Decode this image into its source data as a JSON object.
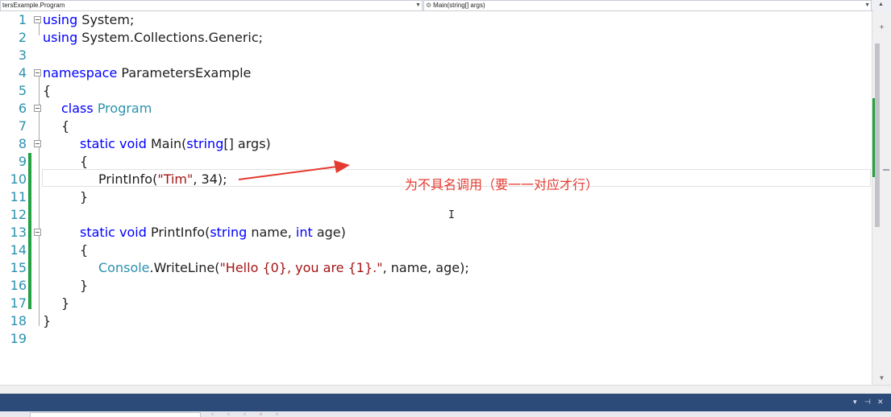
{
  "navbar": {
    "class_dropdown": "tersExample.Program",
    "member_dropdown": "Main(string[] args)"
  },
  "line_numbers": [
    "1",
    "2",
    "3",
    "4",
    "5",
    "6",
    "7",
    "8",
    "9",
    "10",
    "11",
    "12",
    "13",
    "14",
    "15",
    "16",
    "17",
    "18",
    "19"
  ],
  "code": {
    "l1_kw": "using",
    "l1_rest": " System;",
    "l2_kw": "using",
    "l2_rest": " System.Collections.Generic;",
    "l4_kw": "namespace",
    "l4_rest": " ParametersExample",
    "brace_open": "{",
    "brace_close": "}",
    "l6_kw": "class",
    "l6_ty": "Program",
    "l8_kw1": "static",
    "l8_kw2": "void",
    "l8_name": " Main(",
    "l8_kw3": "string",
    "l8_rest": "[] args)",
    "l10_call": "PrintInfo(",
    "l10_str": "\"Tim\"",
    "l10_rest": ", 34);",
    "l13_kw1": "static",
    "l13_kw2": "void",
    "l13_name": " PrintInfo(",
    "l13_kw3": "string",
    "l13_mid": " name, ",
    "l13_kw4": "int",
    "l13_rest": " age)",
    "l15_ty": "Console",
    "l15_call": ".WriteLine(",
    "l15_str": "\"Hello {0}, you are {1}.\"",
    "l15_rest": ", name, age);"
  },
  "annotation": {
    "text": "为不具名调用（要一一对应才行）",
    "color": "#e53a2f"
  },
  "colors": {
    "keyword": "#0000ff",
    "type": "#2b91af",
    "string": "#a31515",
    "line_number": "#2b91af",
    "change_bar": "#25a244",
    "panel_header": "#2d4b79"
  },
  "icons": {
    "dropdown": "chevron-down-icon",
    "member": "method-icon",
    "scroll_up": "scroll-up-arrow-icon",
    "scroll_down": "scroll-down-arrow-icon",
    "split": "split-plus-icon",
    "cursor": "ibeam-cursor-icon",
    "pin": "pin-icon",
    "close": "close-icon"
  }
}
